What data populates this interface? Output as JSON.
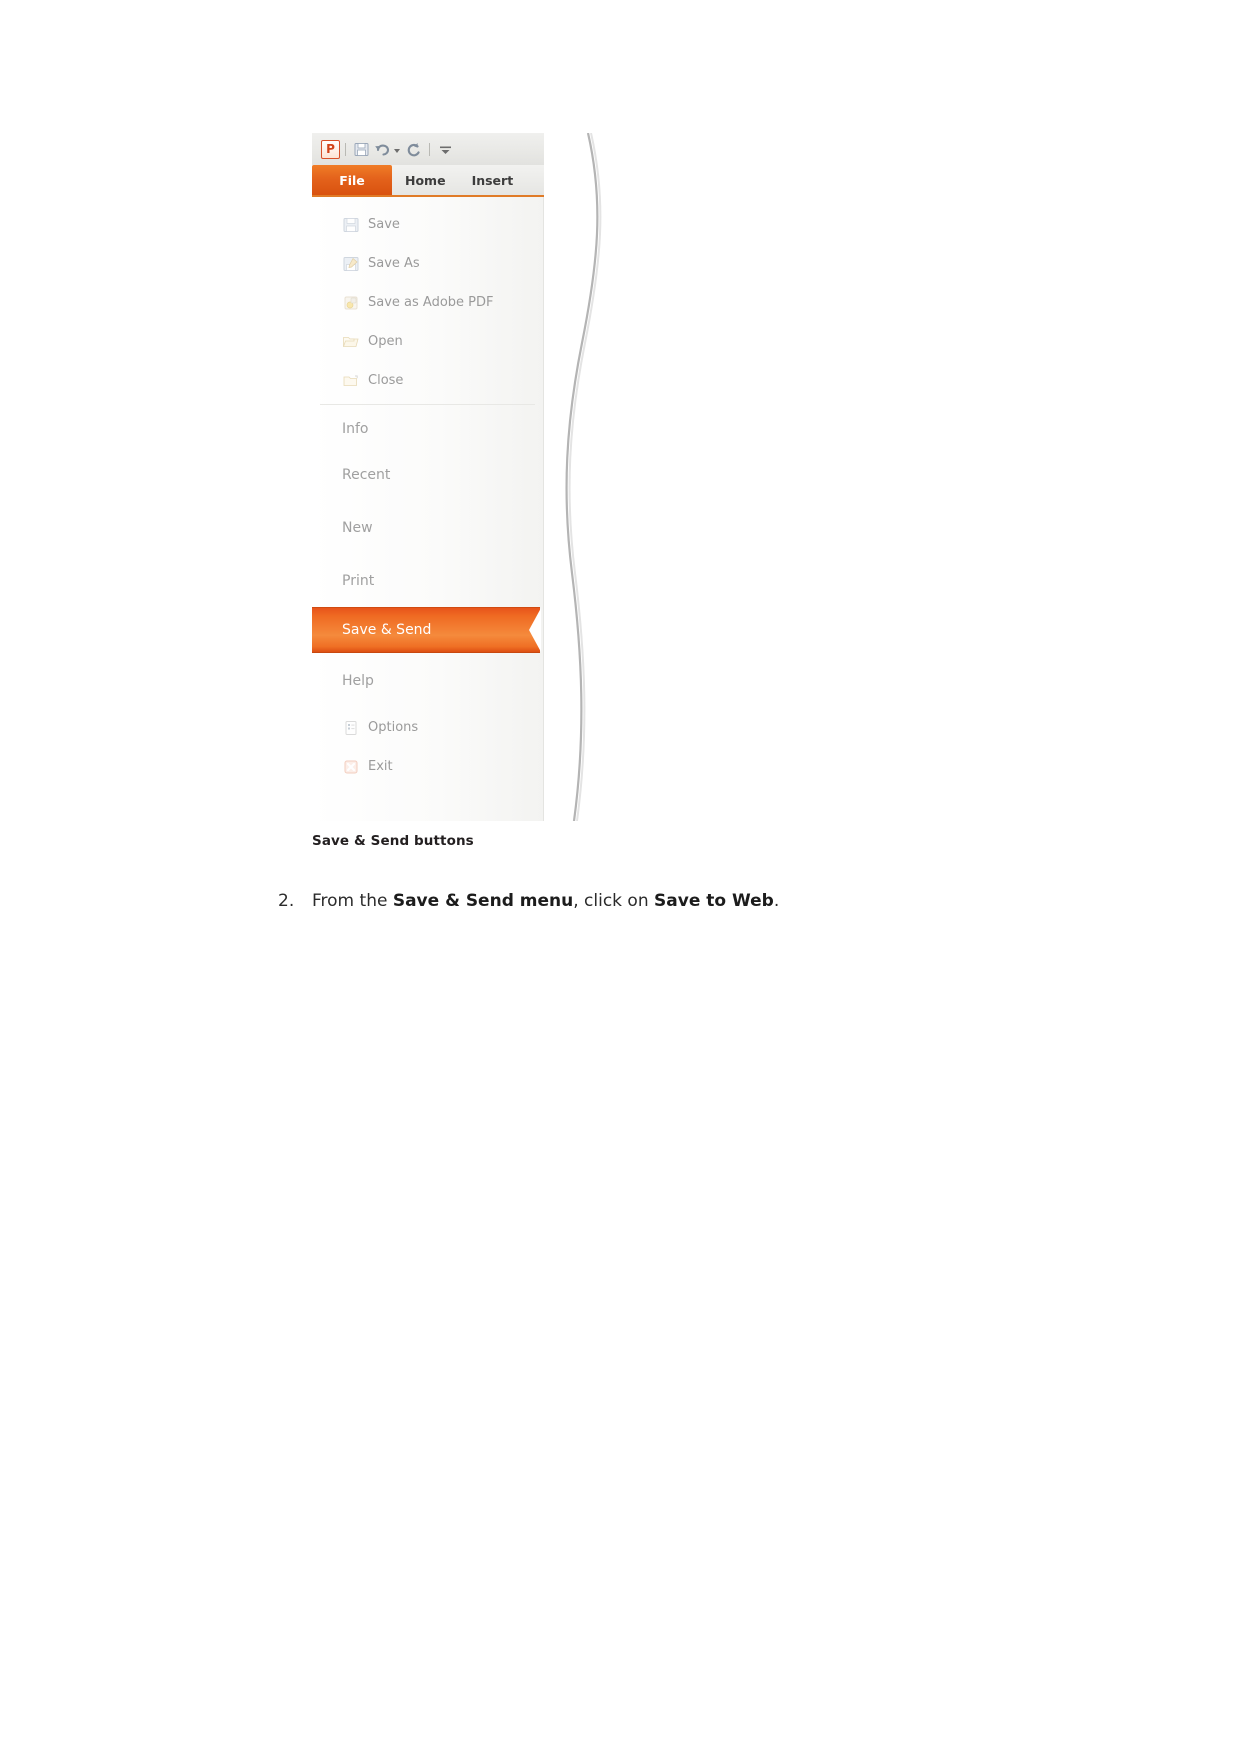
{
  "figure": {
    "app": {
      "quick_access": {
        "logo_letter": "P",
        "items": [
          {
            "name": "save-icon",
            "tooltip": "Save"
          },
          {
            "name": "undo-icon",
            "tooltip": "Undo"
          },
          {
            "name": "undo-dropdown-caret",
            "tooltip": "Undo options"
          },
          {
            "name": "redo-icon",
            "tooltip": "Redo"
          },
          {
            "name": "customize-quick-access-caret",
            "tooltip": "Customize Quick Access Toolbar"
          }
        ]
      },
      "ribbon_tabs": [
        {
          "label": "File",
          "active": true
        },
        {
          "label": "Home",
          "active": false
        },
        {
          "label": "Insert",
          "active": false
        }
      ],
      "backstage_menu": [
        {
          "label": "Save",
          "icon": "floppy-disk-icon",
          "selected": false
        },
        {
          "label": "Save As",
          "icon": "save-as-icon",
          "selected": false
        },
        {
          "label": "Save as Adobe PDF",
          "icon": "adobe-pdf-icon",
          "selected": false
        },
        {
          "label": "Open",
          "icon": "open-folder-icon",
          "selected": false
        },
        {
          "label": "Close",
          "icon": "close-folder-icon",
          "selected": false
        },
        {
          "label": "Info",
          "icon": null,
          "selected": false
        },
        {
          "label": "Recent",
          "icon": null,
          "selected": false
        },
        {
          "label": "New",
          "icon": null,
          "selected": false
        },
        {
          "label": "Print",
          "icon": null,
          "selected": false
        },
        {
          "label": "Save & Send",
          "icon": null,
          "selected": true
        },
        {
          "label": "Help",
          "icon": null,
          "selected": false
        },
        {
          "label": "Options",
          "icon": "options-icon",
          "selected": false
        },
        {
          "label": "Exit",
          "icon": "exit-icon",
          "selected": false
        }
      ]
    },
    "caption": "Save & Send buttons"
  },
  "step": {
    "number": "2.",
    "text_part_1": "From the ",
    "bold_1": "Save & Send menu",
    "text_part_2": ", click on ",
    "bold_2": "Save to Web",
    "text_part_3": "."
  },
  "colors": {
    "accent_orange": "#e3611b",
    "highlight_gradient_top": "#e8541a",
    "highlight_gradient_mid": "#f58a3c",
    "menu_text_gray": "#9a9a9a",
    "body_text": "#2b2b2b"
  }
}
